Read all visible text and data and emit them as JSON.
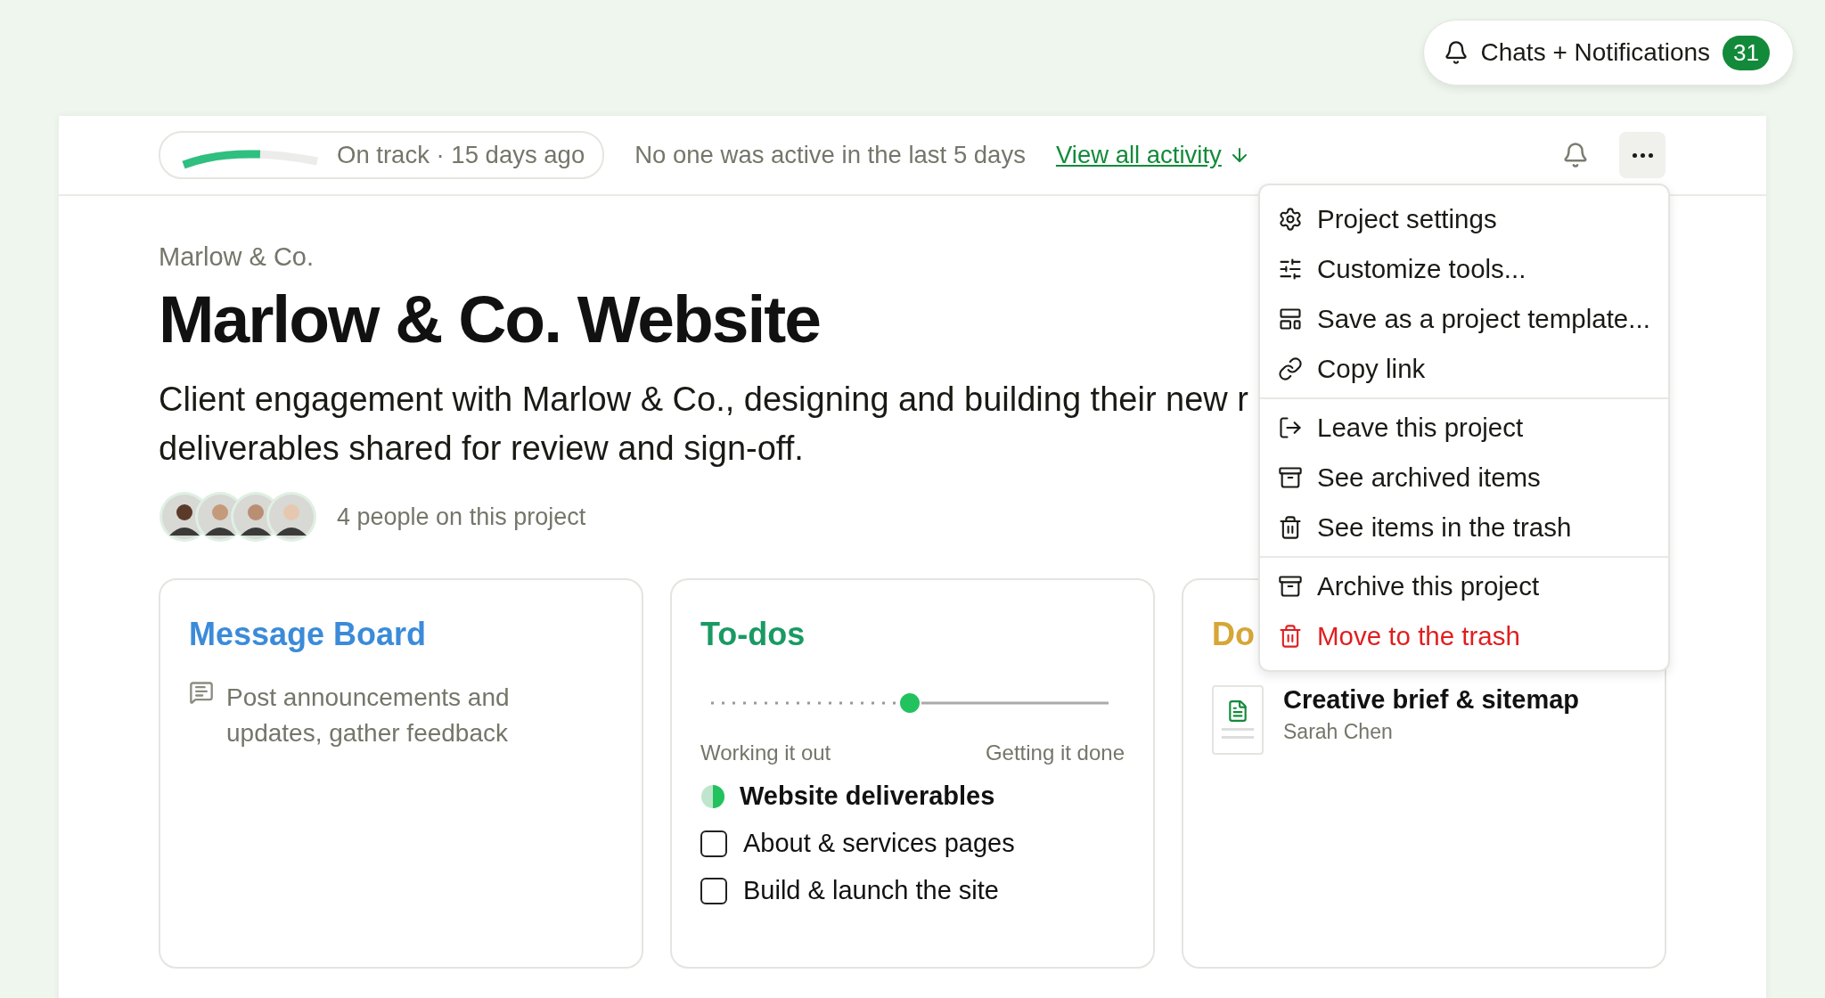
{
  "notifications_button": {
    "label": "Chats + Notifications",
    "count": "31"
  },
  "status": {
    "level": 0.62,
    "label": "On track · 15 days ago"
  },
  "activity_note": "No one was active in the last 5 days",
  "activity_link": "View all activity",
  "project": {
    "client": "Marlow & Co.",
    "title": "Marlow & Co. Website",
    "description_lines": [
      "Client engagement with Marlow & Co., designing and building their new r",
      "deliverables shared for review and sign-off."
    ],
    "avatars": [
      {
        "kind": "picture"
      },
      {
        "kind": "picture"
      },
      {
        "kind": "picture"
      },
      {
        "kind": "picture"
      }
    ],
    "people_label": "4 people on this project"
  },
  "menu": {
    "sections": [
      {
        "items": [
          {
            "label": "Project settings",
            "danger": false
          },
          {
            "label": "Customize tools...",
            "danger": false
          },
          {
            "label": "Save as a project template...",
            "danger": false
          },
          {
            "label": "Copy link",
            "danger": false
          }
        ]
      },
      {
        "items": [
          {
            "label": "Leave this project",
            "danger": false
          },
          {
            "label": "See archived items",
            "danger": false
          },
          {
            "label": "See items in the trash",
            "danger": false
          }
        ]
      },
      {
        "items": [
          {
            "label": "Archive this project",
            "danger": false
          },
          {
            "label": "Move to the trash",
            "danger": true
          }
        ]
      }
    ]
  },
  "cards": [
    {
      "kind": "messages",
      "title": "Message Board",
      "color": "#3b8bd9",
      "blurb": "Post announcements and updates, gather feedback"
    },
    {
      "kind": "todos",
      "title": "To-dos",
      "color": "#1a9a63",
      "hill": {
        "level": 0.5,
        "left_label": "Working it out",
        "right_label": "Getting it done"
      },
      "list": {
        "title": "Website deliverables",
        "items": [
          {
            "label": "About & services pages",
            "checked": false
          },
          {
            "label": "Build & launch the site",
            "checked": false
          }
        ]
      }
    },
    {
      "kind": "docs",
      "title": "Do",
      "color": "#d6a636",
      "doc": {
        "title": "Creative brief & sitemap",
        "author": "Sarah Chen"
      }
    }
  ]
}
